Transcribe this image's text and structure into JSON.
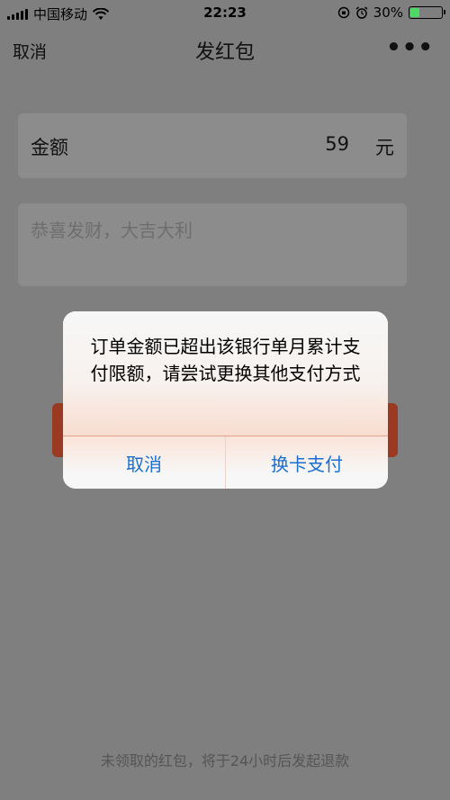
{
  "status_bar": {
    "carrier": "中国移动",
    "time": "22:23",
    "battery_percent": "30%",
    "battery_level": 0.3,
    "battery_color": "#4cd964"
  },
  "nav": {
    "cancel_label": "取消",
    "title": "发红包",
    "more_icon": "more-dots-icon"
  },
  "amount": {
    "label": "金额",
    "value": "59",
    "unit": "元"
  },
  "message": {
    "placeholder": "恭喜发财，大吉大利"
  },
  "footer_note": "未领取的红包，将于24小时后发起退款",
  "alert": {
    "message": "订单金额已超出该银行单月累计支付限额，请尝试更换其他支付方式",
    "cancel_label": "取消",
    "change_card_label": "换卡支付",
    "button_color": "#1a6fd1"
  }
}
